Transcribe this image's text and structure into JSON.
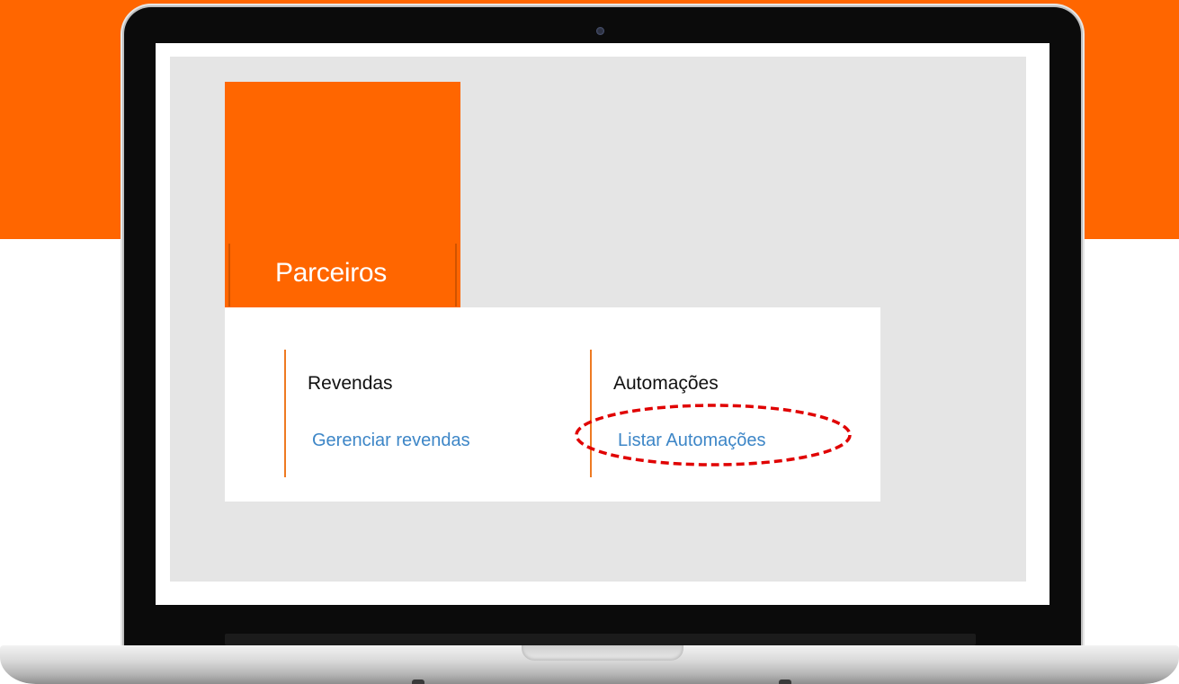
{
  "colors": {
    "brand_orange": "#ff6600",
    "link_blue": "#3d86c7",
    "divider_orange": "#ee7a22",
    "highlight_red": "#e00000"
  },
  "tile": {
    "title": "Parceiros"
  },
  "menu": {
    "columns": [
      {
        "heading": "Revendas",
        "link": "Gerenciar revendas"
      },
      {
        "heading": "Automações",
        "link": "Listar Automações"
      }
    ]
  },
  "annotation": {
    "style": "red-dashed-ellipse",
    "target": "Listar Automações"
  }
}
